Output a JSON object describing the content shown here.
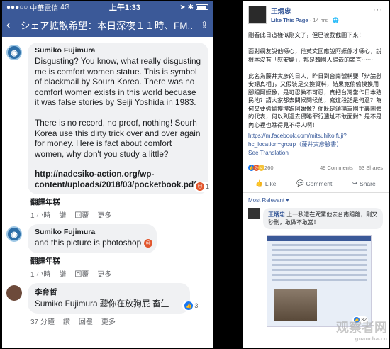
{
  "left": {
    "status": {
      "carrier": "中華電信",
      "network": "4G",
      "time": "上午1:33"
    },
    "nav": {
      "title": "シェア拡散希望：本日深夜１１時、FM..."
    },
    "comments": [
      {
        "author": "Sumiko Fujimura",
        "text": "Disgusting? You know, what really disgusting me is comfort women statue. This is symbol of blackmail by Sourh Korea. There was no comfort women exists in this world becuase it was false stories by Seiji Yoshida in 1983.\n\nThere is no record, no proof, nothing! Sourh Korea use this dirty trick over and over again for money. Here is fact about comfort women, why don't you study a little?",
        "link": "http://nadesiko-action.org/wp-content/uploads/2018/03/pocketbook.pdf",
        "reaction_count": "1",
        "translate": "翻譯年糕",
        "actions": [
          "1 小時",
          "讚",
          "回覆",
          "更多"
        ]
      },
      {
        "author": "Sumiko Fujimura",
        "text": "and this picture is photoshop",
        "translate": "翻譯年糕",
        "actions": [
          "1 小時",
          "讚",
          "回覆",
          "更多"
        ]
      },
      {
        "author": "李育哲",
        "text": "Sumiko Fujimura 聽你在放狗屁 畜生",
        "reaction_count": "3",
        "actions": [
          "37 分鐘",
          "讚",
          "回覆",
          "更多"
        ]
      }
    ]
  },
  "right": {
    "page_name": "王炳忠",
    "meta_link": "Like This Page",
    "meta_time": "· 14 hrs ·",
    "more": "···",
    "post_text": "剛看此日這樣似剛文了，但已被我截圖下來！\n\n面對網友說他噁心，他英文回應說阿嬤像才噁心，說根本沒有「慰安婦」，都是韓國人編造的謊言⋯⋯\n\n此名為藤井実彦的日人，昨日到台南號稱要「辯論慰安婦真相」，又假裝是交換資料，結果竟偷偷摸摸用腳踢阿嬤像，是可忍孰不可忍，真把台灣當作日本殖民地？請大家都去問候問候他，寫這段話是何意？為何又要偷偷摸摸踢阿嬤像？你既是頌揚軍國主義團體的代表，何以到過去侵略罪行遺址不敢面對？是不是內心裡也瞧得見不得人啊！",
    "post_link": "https://m.facebook.com/mitsuhiko.fuji?hc_location=group（藤井実彦臉書）",
    "see_translation": "See Translation",
    "reactions": "260",
    "comments_count": "49 Comments",
    "shares_count": "53 Shares",
    "actions": {
      "like": "Like",
      "comment": "Comment",
      "share": "Share"
    },
    "most_relevant": "Most Relevant ▾",
    "reply_author": "王炳忠",
    "reply_text": "上一秒還在咒罵他去台南踢館，剛又秒刪，敢做不敢當！",
    "nested_reactions": "32"
  },
  "watermark": {
    "main": "观察者网",
    "sub": "guancha.cn"
  }
}
